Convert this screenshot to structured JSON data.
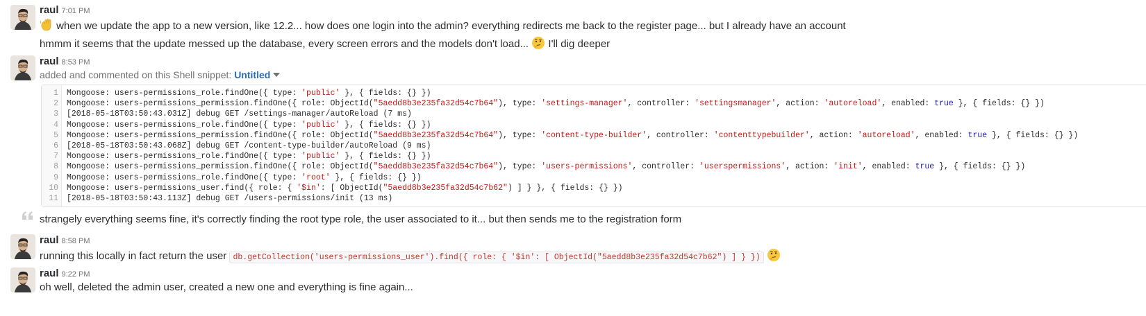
{
  "messages": [
    {
      "author": "raul",
      "time": "7:01 PM",
      "lines": [
        "when we update the app to a new version, like 12.2... how does one login into the admin? everything redirects me back to the register page... but I already have an account",
        "hmmm it seems that the update messed up the database, every screen errors and the models don't load...",
        "I'll dig deeper"
      ]
    },
    {
      "author": "raul",
      "time": "8:53 PM",
      "action_text": "added and commented on this Shell snippet:",
      "snippet_title": "Untitled",
      "code_lines": [
        [
          {
            "t": "Mongoose: users-permissions_role.findOne({ type: "
          },
          {
            "t": "'public'",
            "c": "str"
          },
          {
            "t": " }, { fields: {} })"
          }
        ],
        [
          {
            "t": "Mongoose: users-permissions_permission.findOne({ role: ObjectId("
          },
          {
            "t": "\"5aedd8b3e235fa32d54c7b64\"",
            "c": "str"
          },
          {
            "t": "), type: "
          },
          {
            "t": "'settings-manager'",
            "c": "str"
          },
          {
            "t": ", controller: "
          },
          {
            "t": "'settingsmanager'",
            "c": "str"
          },
          {
            "t": ", action: "
          },
          {
            "t": "'autoreload'",
            "c": "str"
          },
          {
            "t": ", enabled: "
          },
          {
            "t": "true",
            "c": "kw"
          },
          {
            "t": " }, { fields: {} })"
          }
        ],
        [
          {
            "t": "[2018-05-18T03:50:43.031Z] debug GET /settings-manager/autoReload (7 ms)"
          }
        ],
        [
          {
            "t": "Mongoose: users-permissions_role.findOne({ type: "
          },
          {
            "t": "'public'",
            "c": "str"
          },
          {
            "t": " }, { fields: {} })"
          }
        ],
        [
          {
            "t": "Mongoose: users-permissions_permission.findOne({ role: ObjectId("
          },
          {
            "t": "\"5aedd8b3e235fa32d54c7b64\"",
            "c": "str"
          },
          {
            "t": "), type: "
          },
          {
            "t": "'content-type-builder'",
            "c": "str"
          },
          {
            "t": ", controller: "
          },
          {
            "t": "'contenttypebuilder'",
            "c": "str"
          },
          {
            "t": ", action: "
          },
          {
            "t": "'autoreload'",
            "c": "str"
          },
          {
            "t": ", enabled: "
          },
          {
            "t": "true",
            "c": "kw"
          },
          {
            "t": " }, { fields: {} })"
          }
        ],
        [
          {
            "t": "[2018-05-18T03:50:43.068Z] debug GET /content-type-builder/autoReload (9 ms)"
          }
        ],
        [
          {
            "t": "Mongoose: users-permissions_role.findOne({ type: "
          },
          {
            "t": "'public'",
            "c": "str"
          },
          {
            "t": " }, { fields: {} })"
          }
        ],
        [
          {
            "t": "Mongoose: users-permissions_permission.findOne({ role: ObjectId("
          },
          {
            "t": "\"5aedd8b3e235fa32d54c7b64\"",
            "c": "str"
          },
          {
            "t": "), type: "
          },
          {
            "t": "'users-permissions'",
            "c": "str"
          },
          {
            "t": ", controller: "
          },
          {
            "t": "'userspermissions'",
            "c": "str"
          },
          {
            "t": ", action: "
          },
          {
            "t": "'init'",
            "c": "str"
          },
          {
            "t": ", enabled: "
          },
          {
            "t": "true",
            "c": "kw"
          },
          {
            "t": " }, { fields: {} })"
          }
        ],
        [
          {
            "t": "Mongoose: users-permissions_role.findOne({ type: "
          },
          {
            "t": "'root'",
            "c": "str"
          },
          {
            "t": " }, { fields: {} })"
          }
        ],
        [
          {
            "t": "Mongoose: users-permissions_user.find({ role: { "
          },
          {
            "t": "'$in'",
            "c": "str"
          },
          {
            "t": ": [ ObjectId("
          },
          {
            "t": "\"5aedd8b3e235fa32d54c7b62\"",
            "c": "str"
          },
          {
            "t": ") ] } }, { fields: {} })"
          }
        ],
        [
          {
            "t": "[2018-05-18T03:50:43.113Z] debug GET /users-permissions/init (13 ms)"
          }
        ]
      ],
      "comment": "strangely everything seems fine, it's correctly finding the root type role, the user associated to it... but then sends me to the registration form"
    },
    {
      "author": "raul",
      "time": "8:58 PM",
      "text": "running this locally in fact return the user",
      "inline_code": "db.getCollection('users-permissions_user').find({ role: { '$in': [ ObjectId(\"5aedd8b3e235fa32d54c7b62\") ] } })"
    },
    {
      "author": "raul",
      "time": "9:22 PM",
      "text": "oh well, deleted the admin user, created a new one and everything is fine again..."
    }
  ],
  "icons": {
    "wave": "waving-hand-emoji",
    "thinking": "thinking-face-emoji",
    "quote": "comment-quote-icon",
    "caret": "chevron-down-icon"
  },
  "colors": {
    "link": "#2a6db0",
    "string": "#c41a16",
    "keyword": "#1a1aa6"
  }
}
